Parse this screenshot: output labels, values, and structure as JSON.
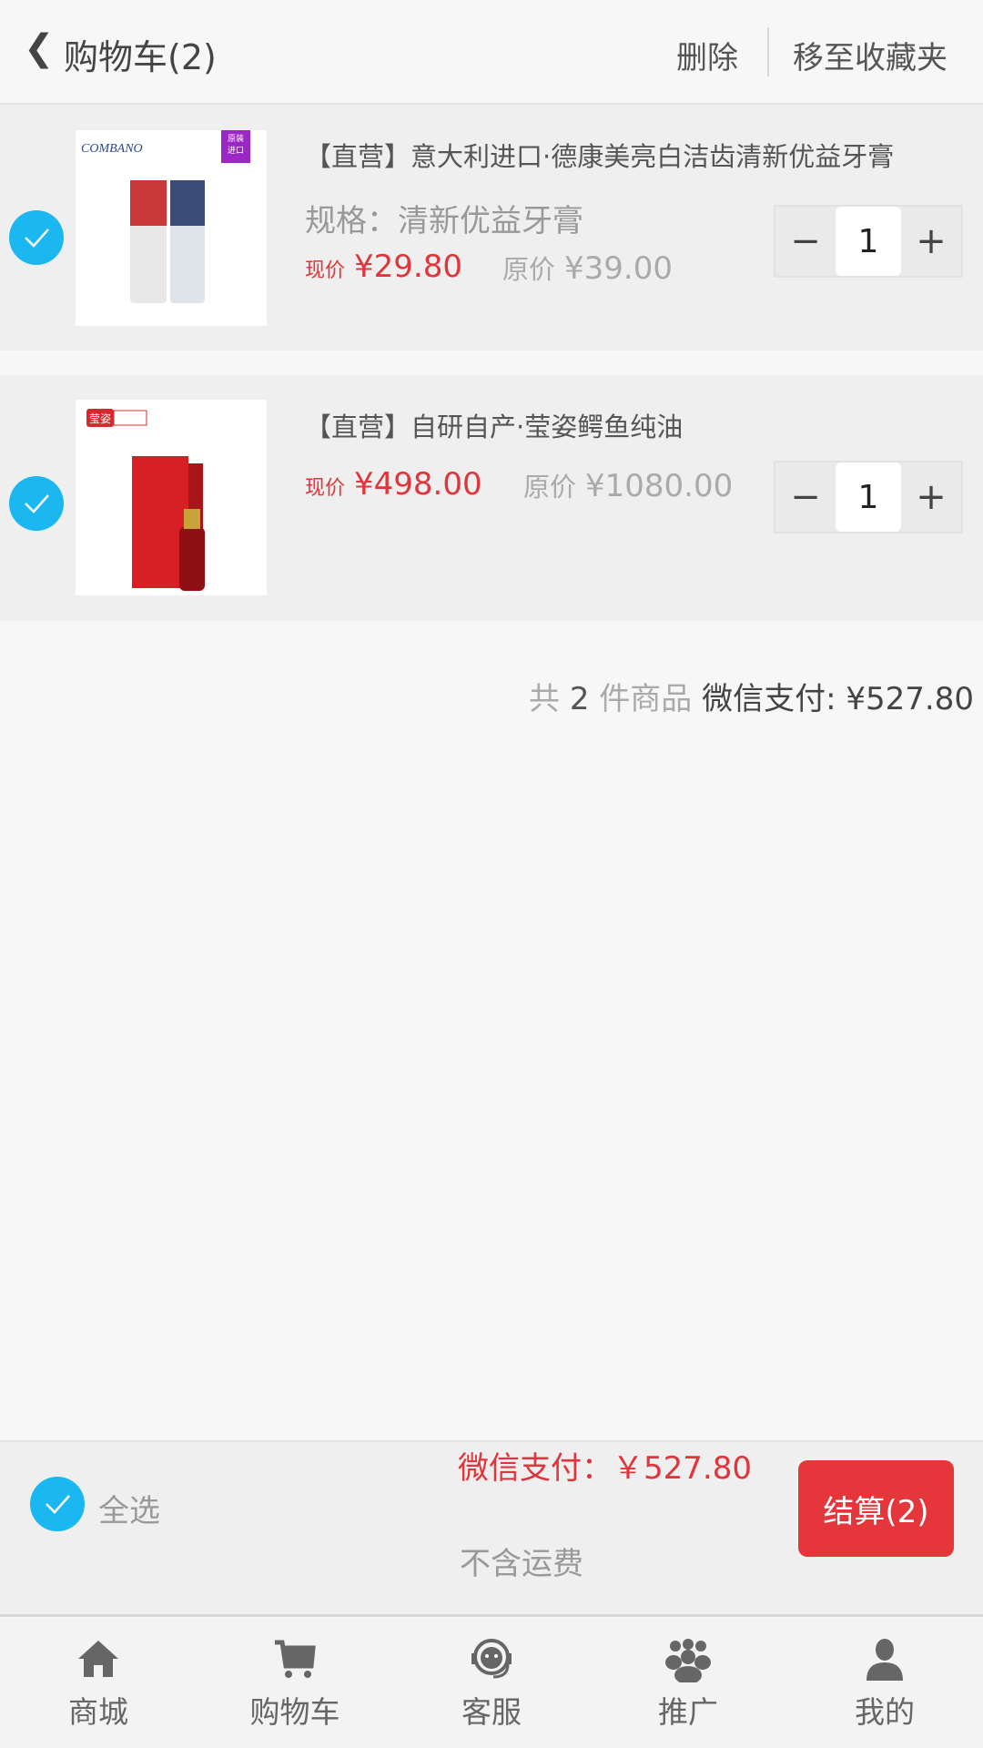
{
  "header": {
    "back_icon": "chevron-left-icon",
    "title": "购物车(2)",
    "delete": "删除",
    "move_to_favorites": "移至收藏夹"
  },
  "items": [
    {
      "checked": true,
      "title": "【直营】意大利进口·德康美亮白洁齿清新优益牙膏",
      "spec": "规格：清新优益牙膏",
      "now_label": "现价",
      "now_price": "¥29.80",
      "orig_label": "原价",
      "orig_price": "¥39.00",
      "qty": "1",
      "badge": "原装进口"
    },
    {
      "checked": true,
      "title": "【直营】自研自产·莹姿鳄鱼纯油",
      "now_label": "现价",
      "now_price": "¥498.00",
      "orig_label": "原价",
      "orig_price": "¥1080.00",
      "qty": "1",
      "brand": "莹姿"
    }
  ],
  "stepper": {
    "minus": "−",
    "plus": "+"
  },
  "summary": {
    "prefix": "共",
    "count": "2",
    "suffix": "件商品",
    "pay_label": "微信支付:",
    "total": "¥527.80"
  },
  "bottom": {
    "select_all": "全选",
    "pay": "微信支付：￥527.80",
    "shipping_note": "不含运费",
    "checkout": "结算(2)"
  },
  "tabs": [
    {
      "label": "商城",
      "icon": "home-icon"
    },
    {
      "label": "购物车",
      "icon": "cart-icon"
    },
    {
      "label": "客服",
      "icon": "headset-icon"
    },
    {
      "label": "推广",
      "icon": "group-icon"
    },
    {
      "label": "我的",
      "icon": "user-icon"
    }
  ],
  "colors": {
    "accent_red": "#e5363b",
    "check_blue": "#1ab7f0"
  }
}
